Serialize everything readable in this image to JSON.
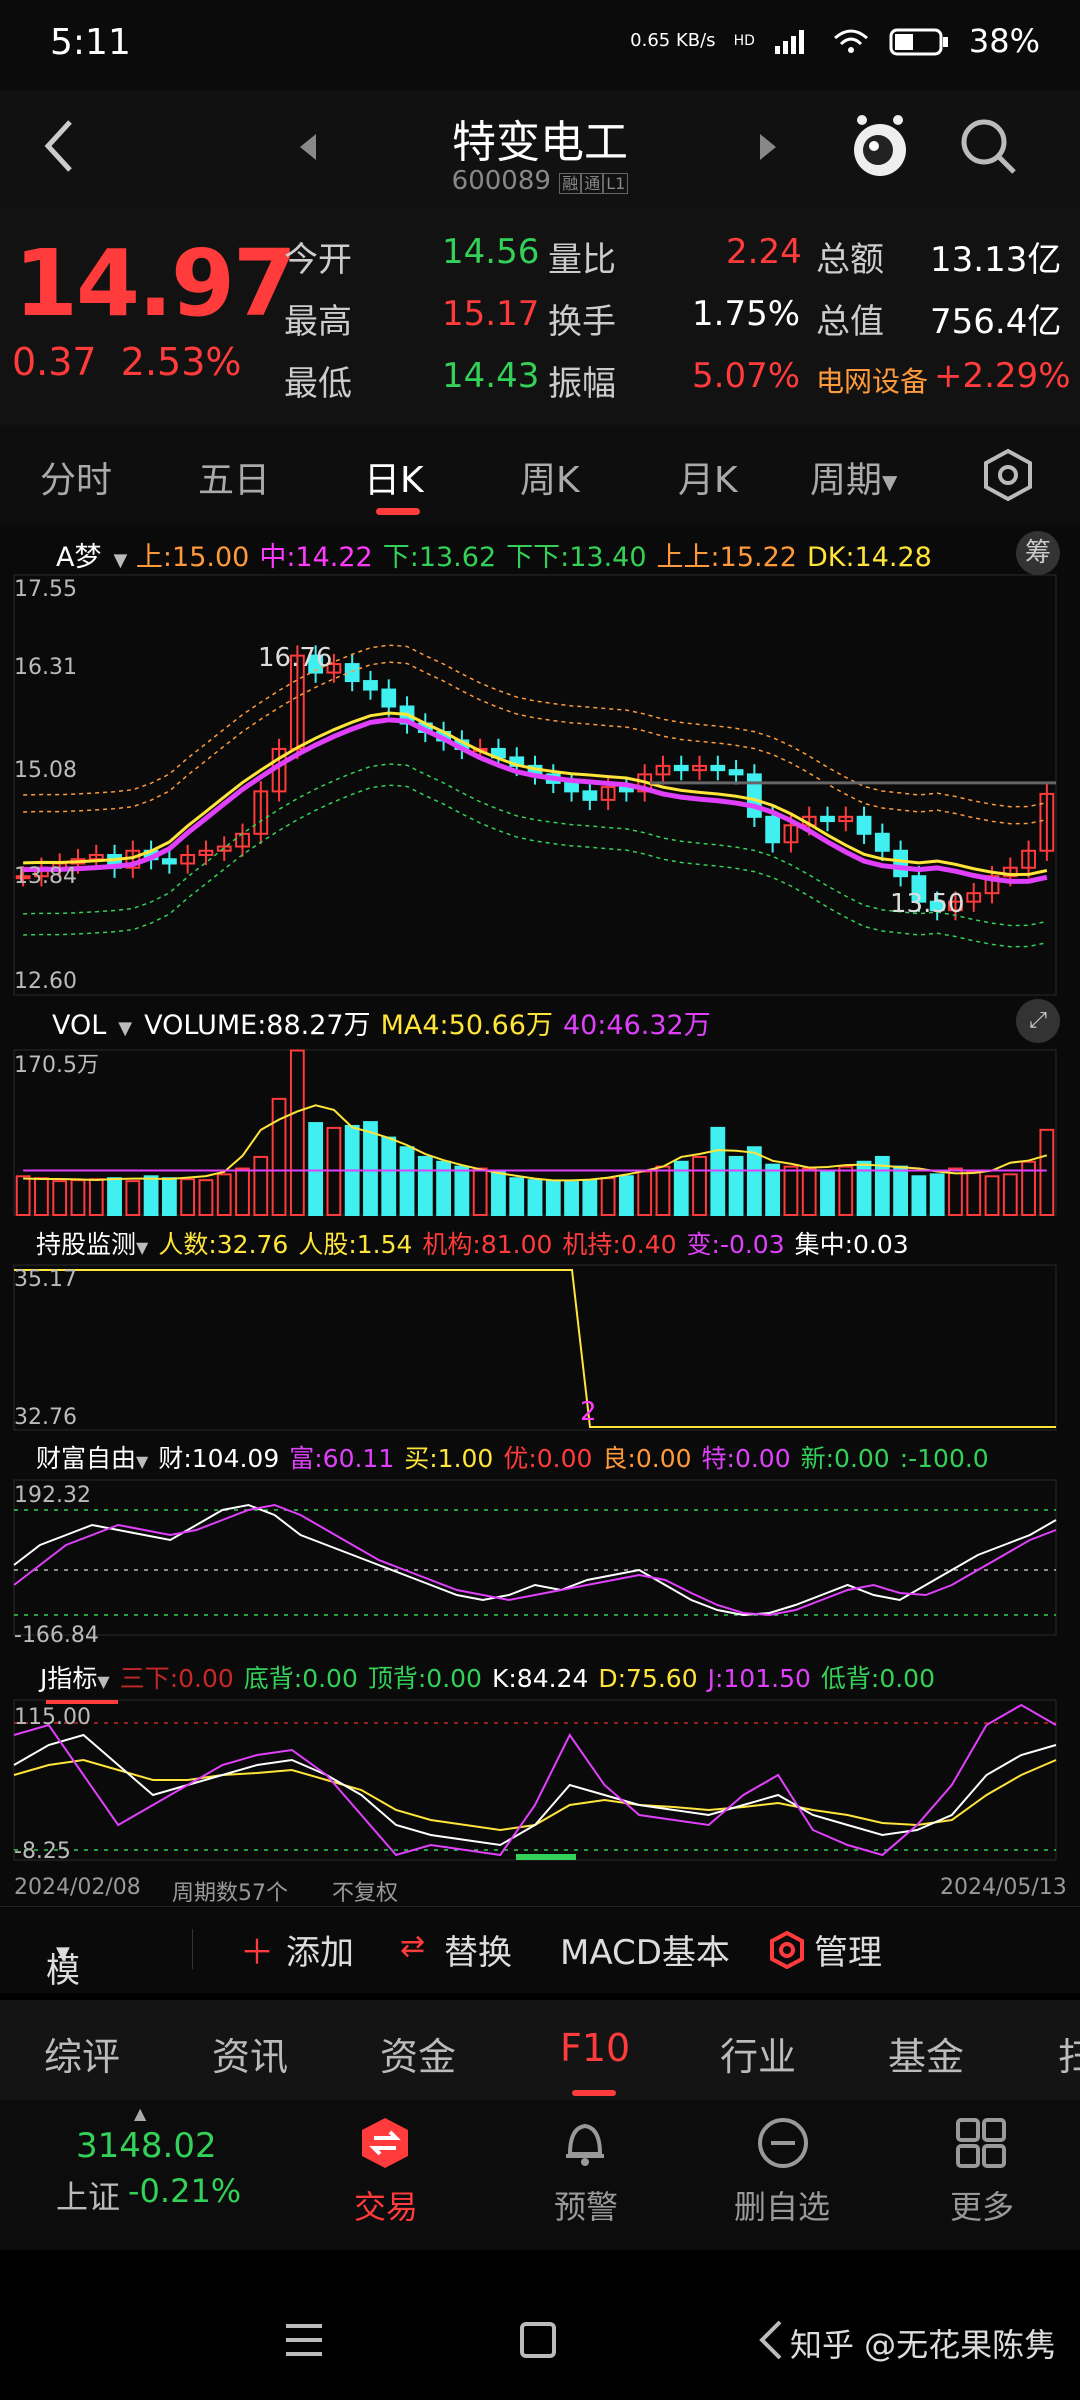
{
  "status": {
    "time": "5:11",
    "net_speed": "0.65 KB/s",
    "hd": "HD",
    "battery": "38%"
  },
  "header": {
    "title": "特变电工",
    "code": "600089",
    "badge1": "融",
    "badge2": "通",
    "badge3": "L1"
  },
  "quote": {
    "price": "14.97",
    "change": "0.37",
    "change_pct": "2.53%",
    "open_lbl": "今开",
    "open": "14.56",
    "vr_lbl": "量比",
    "vr": "2.24",
    "amt_lbl": "总额",
    "amt": "13.13亿",
    "high_lbl": "最高",
    "high": "15.17",
    "turn_lbl": "换手",
    "turn": "1.75%",
    "mcap_lbl": "总值",
    "mcap": "756.4亿",
    "low_lbl": "最低",
    "low": "14.43",
    "amp_lbl": "振幅",
    "amp": "5.07%",
    "sector": "电网设备",
    "sector_pct": "+2.29%"
  },
  "tabs": [
    "分时",
    "五日",
    "日K",
    "周K",
    "月K",
    "周期"
  ],
  "active_tab": "日K",
  "kline": {
    "indicator": "A梦",
    "legend": [
      {
        "t": "上:15.00",
        "c": "#ff9a3c"
      },
      {
        "t": "中:14.22",
        "c": "#ff3bff"
      },
      {
        "t": "下:13.62",
        "c": "#34d158"
      },
      {
        "t": "下下:13.40",
        "c": "#34d158"
      },
      {
        "t": "上上:15.22",
        "c": "#ff9a3c"
      },
      {
        "t": "DK:14.28",
        "c": "#ffe43a"
      }
    ],
    "chip_btn": "筹",
    "y_labels": [
      "17.55",
      "16.31",
      "15.08",
      "13.84",
      "12.60"
    ],
    "max_label": "16.76",
    "min_label": "13.50",
    "colors": {
      "up": "#ff3b3b",
      "down": "#40f0f0"
    }
  },
  "vol": {
    "name": "VOL",
    "legend": [
      {
        "t": "VOLUME:88.27万",
        "c": "#ffffff"
      },
      {
        "t": "MA4:50.66万",
        "c": "#ffe43a"
      },
      {
        "t": "40:46.32万",
        "c": "#e040fb"
      }
    ],
    "y_label": "170.5万"
  },
  "holders": {
    "name": "持股监测",
    "legend": [
      {
        "t": "人数:32.76",
        "c": "#ffe43a"
      },
      {
        "t": "人股:1.54",
        "c": "#ffe43a"
      },
      {
        "t": "机构:81.00",
        "c": "#ff3b3b"
      },
      {
        "t": "机持:0.40",
        "c": "#ff3b3b"
      },
      {
        "t": "变:-0.03",
        "c": "#e040fb"
      },
      {
        "t": "集中:0.03",
        "c": "#ffffff"
      }
    ],
    "y_top": "35.17",
    "y_bot": "32.76",
    "marker": "2"
  },
  "wealth": {
    "name": "财富自由",
    "legend": [
      {
        "t": "财:104.09",
        "c": "#ffffff"
      },
      {
        "t": "富:60.11",
        "c": "#e040fb"
      },
      {
        "t": "买:1.00",
        "c": "#ffe43a"
      },
      {
        "t": "优:0.00",
        "c": "#ff3b3b"
      },
      {
        "t": "良:0.00",
        "c": "#ff9a3c"
      },
      {
        "t": "特:0.00",
        "c": "#e040fb"
      },
      {
        "t": "新:0.00",
        "c": "#34d158"
      },
      {
        "t": ":-100.0",
        "c": "#34d158"
      }
    ],
    "y_top": "192.32",
    "y_bot": "-166.84"
  },
  "jind": {
    "name": "J指标",
    "legend": [
      {
        "t": "三下:0.00",
        "c": "#c62828"
      },
      {
        "t": "底背:0.00",
        "c": "#34d158"
      },
      {
        "t": "顶背:0.00",
        "c": "#34d158"
      },
      {
        "t": "K:84.24",
        "c": "#ffffff"
      },
      {
        "t": "D:75.60",
        "c": "#ffe43a"
      },
      {
        "t": "J:101.50",
        "c": "#e040fb"
      },
      {
        "t": "低背:0.00",
        "c": "#34d158"
      }
    ],
    "y_top": "115.00",
    "y_bot": "-8.25"
  },
  "footer_axis": {
    "start": "2024/02/08",
    "count": "周期数57个",
    "adj": "不复权",
    "end": "2024/05/13"
  },
  "toolbar": {
    "template": "模板",
    "add": "添加",
    "replace": "替换",
    "macd": "MACD基本",
    "manage": "管理"
  },
  "ftabs": [
    "综评",
    "资讯",
    "资金",
    "F10",
    "行业",
    "基金",
    "扫"
  ],
  "active_ftab": "F10",
  "bottomnav": {
    "index_val": "3148.02",
    "index_name": "上证",
    "index_pct": "-0.21%",
    "trade": "交易",
    "alert": "预警",
    "remove": "删自选",
    "more": "更多"
  },
  "watermark": "知乎 @无花果陈隽"
}
